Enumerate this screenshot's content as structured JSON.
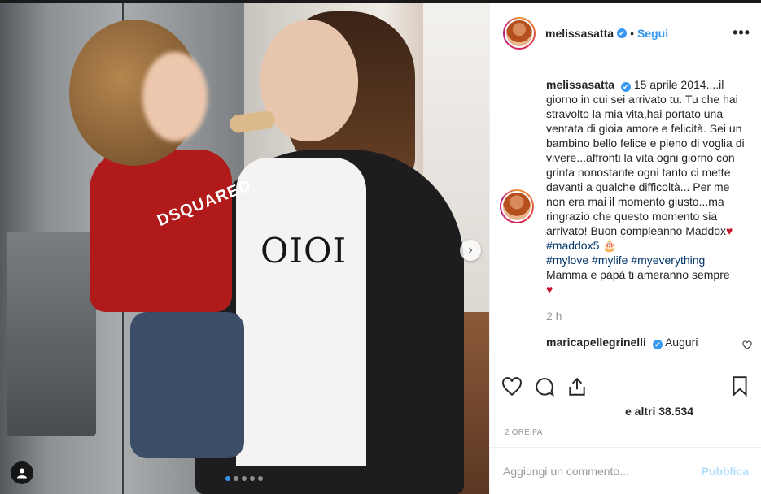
{
  "colors": {
    "accent": "#3897f0",
    "hashtag": "#003569",
    "heart": "#c5152b",
    "muted": "#999999",
    "publish_disabled": "#b2dffc"
  },
  "post": {
    "image": {
      "shirt_text": "DSQUARED",
      "tshirt_text": "OIOI",
      "carousel_total": 5,
      "carousel_active": 1
    },
    "header": {
      "username": "melissasatta",
      "verified": "✔",
      "bullet": "•",
      "follow_label": "Segui",
      "more_label": "•••"
    },
    "caption": {
      "username": "melissasatta",
      "text_part1": "15 aprile 2014....il giorno in cui sei arrivato tu. Tu che hai stravolto la mia vita,hai portato una ventata di gioia amore e felicità. Sei un bambino bello felice e pieno di voglia di vivere...affronti la vita ogni giorno con grinta nonostante ogni tanto ci mette davanti a qualche difficoltà... Per me non era mai il momento giusto...ma ringrazio che questo momento sia arrivato! Buon compleanno Maddox",
      "heart": "♥",
      "hashtag1": "#maddox5",
      "cake": "🎂",
      "hashtags": [
        "#mylove",
        "#mylife",
        "#myeverything"
      ],
      "closing": "Mamma e papà ti ameranno sempre",
      "heart2": "♥",
      "time": "2 h"
    },
    "comments": [
      {
        "username": "maricapellegrinelli",
        "text": "Auguri"
      }
    ],
    "likes_text": "e altri 38.534",
    "posted_ago": "2 ORE FA",
    "add_comment": {
      "placeholder": "Aggiungi un commento...",
      "publish_label": "Pubblica"
    }
  }
}
